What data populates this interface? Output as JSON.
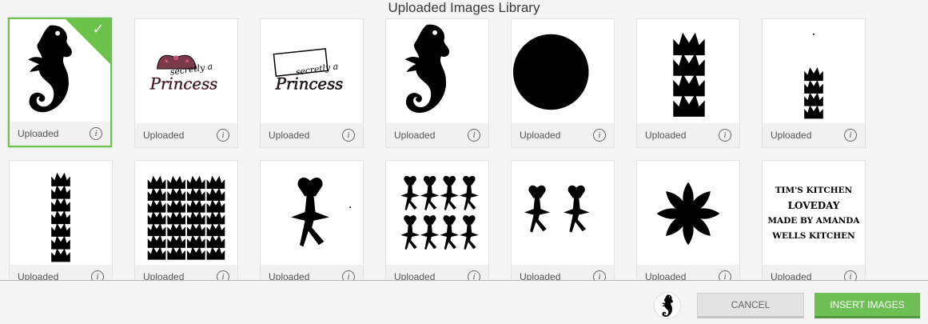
{
  "title": "Uploaded Images Library",
  "selected_index": 0,
  "images": [
    {
      "label": "Uploaded",
      "thumb": "seahorse"
    },
    {
      "label": "Uploaded",
      "thumb": "secretly-a-princess-tiara"
    },
    {
      "label": "Uploaded",
      "thumb": "secretly-a-princess-box"
    },
    {
      "label": "Uploaded",
      "thumb": "seahorse"
    },
    {
      "label": "Uploaded",
      "thumb": "circle"
    },
    {
      "label": "Uploaded",
      "thumb": "crowns-4"
    },
    {
      "label": "Uploaded",
      "thumb": "crowns-4-small"
    },
    {
      "label": "Uploaded",
      "thumb": "crowns-column"
    },
    {
      "label": "Uploaded",
      "thumb": "crowns-grid"
    },
    {
      "label": "Uploaded",
      "thumb": "ballerina"
    },
    {
      "label": "Uploaded",
      "thumb": "ballerinas-8"
    },
    {
      "label": "Uploaded",
      "thumb": "ballerinas-2"
    },
    {
      "label": "Uploaded",
      "thumb": "damask"
    },
    {
      "label": "Uploaded",
      "thumb": "text-lines",
      "text": [
        "TIM'S KITCHEN",
        "LOVEDAY",
        "MADE BY AMANDA",
        "WELLS KITCHEN"
      ]
    }
  ],
  "footer": {
    "selected_thumb": "seahorse",
    "cancel_label": "CANCEL",
    "insert_label": "INSERT IMAGES"
  },
  "colors": {
    "accent": "#6dbf56",
    "selected_border": "#6cc24a",
    "cancel_bg": "#e3e3e3"
  }
}
